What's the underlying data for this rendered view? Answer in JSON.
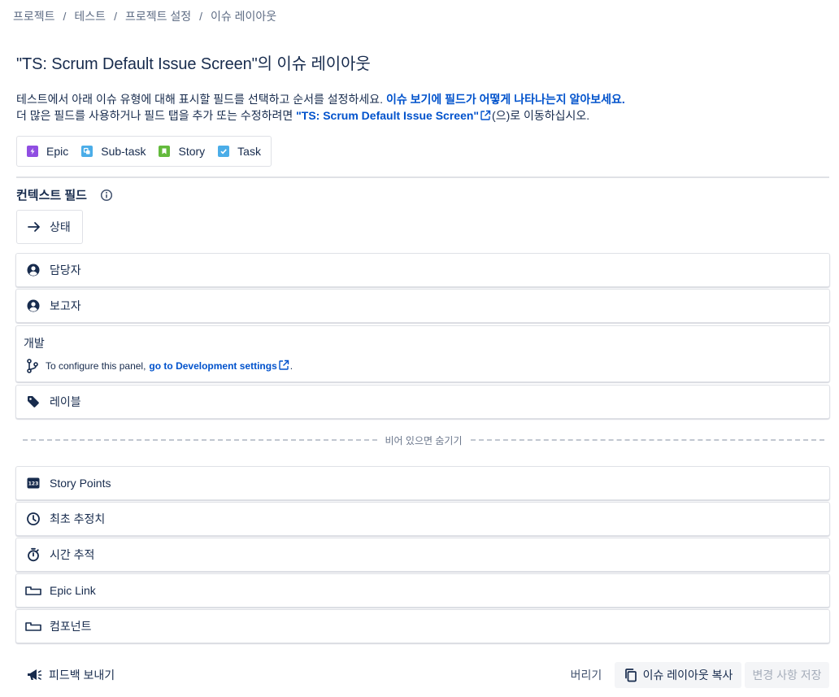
{
  "breadcrumb": [
    "프로젝트",
    "테스트",
    "프로젝트 설정",
    "이슈 레이아웃"
  ],
  "breadcrumb_separator": "/",
  "title": "\"TS: Scrum Default Issue Screen\"의 이슈 레이아웃",
  "description": {
    "line1_text": "테스트에서 아래 이슈 유형에 대해 표시할 필드를 선택하고 순서를 설정하세요. ",
    "line1_link": "이슈 보기에 필드가 어떻게 나타나는지 알아보세요.",
    "line2_text": "더 많은 필드를 사용하거나 필드 탭을 추가 또는 수정하려면 ",
    "line2_link": "\"TS: Scrum Default Issue Screen\"",
    "line2_suffix": "(으)로 이동하십시오."
  },
  "issue_types": [
    {
      "label": "Epic",
      "icon": "epic-icon",
      "color": "#904ee2"
    },
    {
      "label": "Sub-task",
      "icon": "subtask-icon",
      "color": "#4bade8"
    },
    {
      "label": "Story",
      "icon": "story-icon",
      "color": "#63ba3c"
    },
    {
      "label": "Task",
      "icon": "task-icon",
      "color": "#4bade8"
    }
  ],
  "context_section": {
    "title": "컨텍스트 필드",
    "status_label": "상태",
    "fields": [
      {
        "label": "담당자",
        "icon": "person-icon"
      },
      {
        "label": "보고자",
        "icon": "person-icon"
      },
      {
        "label": "레이블",
        "icon": "tag-icon"
      }
    ],
    "development": {
      "title": "개발",
      "text": "To configure this panel,",
      "link": "go to Development settings",
      "suffix": "."
    }
  },
  "hide_when_empty_label": "비어 있으면 숨기기",
  "hidden_fields": [
    {
      "label": "Story Points",
      "icon": "number-icon"
    },
    {
      "label": "최초 추정치",
      "icon": "clock-icon"
    },
    {
      "label": "시간 추적",
      "icon": "stopwatch-icon"
    },
    {
      "label": "Epic Link",
      "icon": "field-icon"
    },
    {
      "label": "컴포넌트",
      "icon": "field-icon"
    }
  ],
  "footer": {
    "feedback_label": "피드백 보내기",
    "discard_label": "버리기",
    "copy_label": "이슈 레이아웃 복사",
    "save_label": "변경 사항 저장"
  },
  "colors": {
    "link": "#0052cc",
    "text": "#172b4d",
    "border": "#dfe1e6",
    "disabled_text": "#a5adba"
  }
}
